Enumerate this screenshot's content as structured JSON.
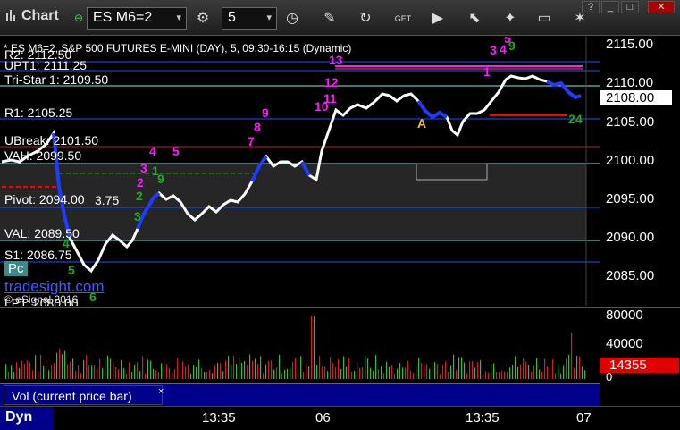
{
  "toolbar": {
    "title": "Chart",
    "symbol": "ES M6=2",
    "interval": "5",
    "window_buttons": [
      "?",
      "_",
      "□",
      "✕"
    ]
  },
  "header": {
    "text": "* ES M6=2, S&P 500 FUTURES E-MINI (DAY), 5, 09:30-16:15 (Dynamic)"
  },
  "levels": {
    "r2": "R2: 2112.50",
    "upt1": "UPT1: 2111.25",
    "tristar": "Tri-Star 1: 2109.50",
    "r1": "R1: 2105.25",
    "ubreak": "UBreak: 2101.50",
    "vah": "VAH: 2099.50",
    "pivot": "Pivot: 2094.00",
    "pivot_extra": "3.75",
    "val": "VAL: 2089.50",
    "s1": "S1: 2086.75",
    "lpt": "LPT: 2080.00"
  },
  "watermark": {
    "brand": "tradesight.com",
    "copyright": "© eSignal 2016",
    "pc": "Pc"
  },
  "price_axis": {
    "ticks": [
      "2115.00",
      "2110.00",
      "2105.00",
      "2100.00",
      "2095.00",
      "2090.00",
      "2085.00"
    ],
    "last_price": "2108.00",
    "last_color": "#ffffff"
  },
  "vol_axis": {
    "ticks": [
      "80000",
      "40000",
      "0"
    ],
    "last_volume": "14355",
    "last_color": "#e00000"
  },
  "volume_label": "Vol (current price bar)",
  "time_axis": {
    "labels": [
      "13:35",
      "06",
      "13:35",
      "07"
    ],
    "corner": "Dyn"
  },
  "signals": {
    "magenta": [
      "4",
      "5",
      "3",
      "2",
      "8",
      "9",
      "7",
      "12",
      "10",
      "11",
      "13",
      "3",
      "4",
      "5",
      "1"
    ],
    "green": [
      "1",
      "9",
      "2",
      "3",
      "4",
      "5",
      "6",
      "9",
      "2",
      "4"
    ],
    "a_marker": "A"
  },
  "colors": {
    "up": "#ffffff",
    "down": "#1e3cff",
    "magenta": "#ff19ff",
    "green": "#1fa91f",
    "red_line": "#ff0000",
    "blue_line": "#1e50ff",
    "teal_line": "#7ff0e0"
  }
}
